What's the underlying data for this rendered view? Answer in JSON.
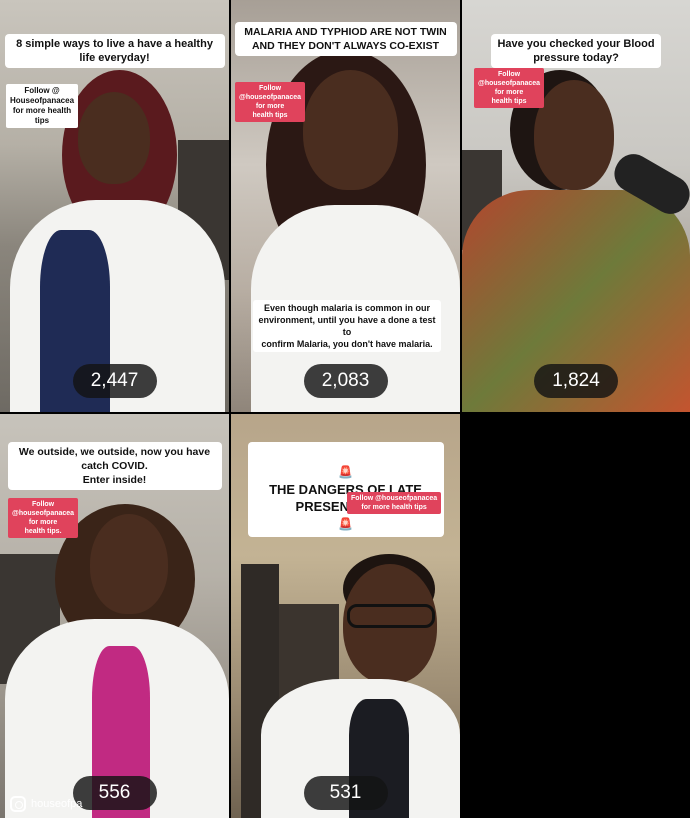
{
  "tiles": [
    {
      "caption": "8 simple ways to live a have a healthy\nlife everyday!",
      "follow": "Follow @\nHouseofpanacea\nfor more health\ntips",
      "views": "2,447"
    },
    {
      "caption": "MALARIA AND TYPHIOD ARE NOT TWIN\nAND THEY DON'T ALWAYS CO-EXIST",
      "follow": "Follow\n@houseofpanacea\nfor more\nhealth tips",
      "note": "Even though malaria is common in our\nenvironment, until you have a done a test to\nconfirm Malaria, you don't have malaria.",
      "views": "2,083"
    },
    {
      "caption": "Have you checked your Blood\npressure today?",
      "follow": "Follow\n@houseofpanacea\nfor more\nhealth tips",
      "views": "1,824"
    },
    {
      "caption": "We outside, we outside, now you have\ncatch COVID.\nEnter inside!",
      "follow": "Follow\n@houseofpanacea\nfor more\nhealth tips.",
      "views": "556",
      "brand": "houseofpa"
    },
    {
      "caption": "THE DANGERS OF LATE\nPRESENTATION",
      "siren_icon": "🚨",
      "follow": "Follow @houseofpanacea\nfor more health tips",
      "views": "531"
    }
  ]
}
